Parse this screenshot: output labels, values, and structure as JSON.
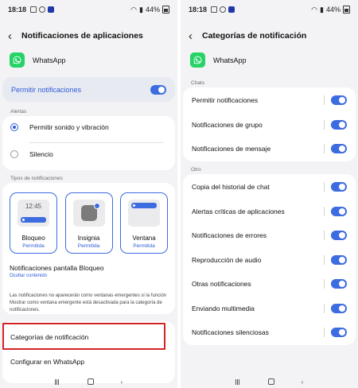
{
  "status_bar": {
    "time": "18:18",
    "battery": "44%"
  },
  "left_screen": {
    "title": "Notificaciones de aplicaciones",
    "app_name": "WhatsApp",
    "permit_label": "Permitir notificaciones",
    "alerts_header": "Alertas",
    "alert_options": [
      "Permitir sonido y vibración",
      "Silencio"
    ],
    "types_header": "Tipos de notificaciones",
    "tiles": [
      {
        "title": "Bloqueo",
        "sub": "Permitida",
        "preview_time": "12:45"
      },
      {
        "title": "Insignia",
        "sub": "Permitida"
      },
      {
        "title": "Ventana",
        "sub": "Permitida"
      }
    ],
    "lock_screen_title": "Notificaciones pantalla Bloqueo",
    "lock_screen_sub": "Ocultar contenido",
    "info_text": "Las notificaciones no aparecerán como ventanas emergentes si la función Mostrar como ventana emergente está desactivada para la categoría de notificaciones.",
    "categories_link": "Categorías de notificación",
    "configure_link": "Configurar en WhatsApp"
  },
  "right_screen": {
    "title": "Categorías de notificación",
    "app_name": "WhatsApp",
    "chats_header": "Chats",
    "chats": [
      "Permitir notificaciones",
      "Notificaciones de grupo",
      "Notificaciones de mensaje"
    ],
    "other_header": "Otro",
    "other": [
      "Copia del historial de chat",
      "Alertas críticas de aplicaciones",
      "Notificaciones de errores",
      "Reproducción de audio",
      "Otras notificaciones",
      "Enviando multimedia",
      "Notificaciones silenciosas"
    ]
  },
  "colors": {
    "accent": "#3d6ce0",
    "highlight": "#d42525",
    "whatsapp": "#25d366"
  }
}
